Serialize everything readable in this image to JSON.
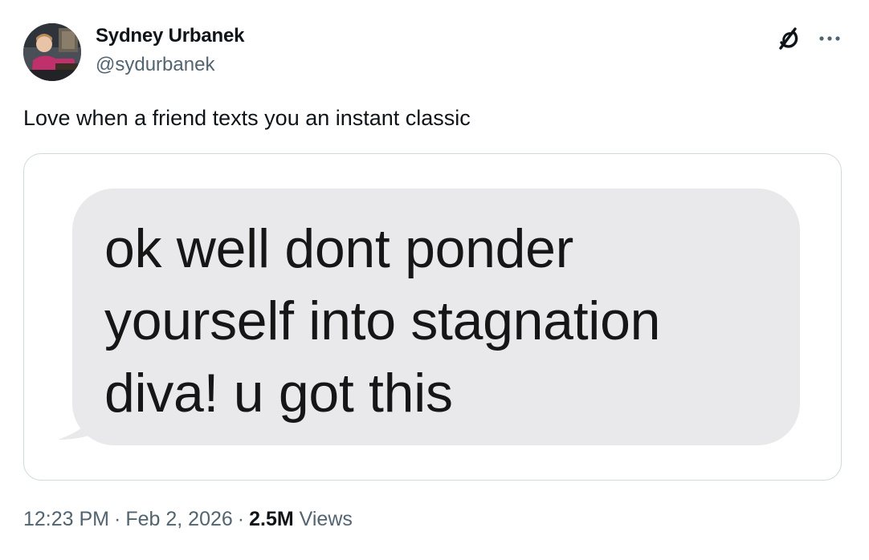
{
  "author": {
    "name": "Sydney Urbanek",
    "handle": "@sydurbanek"
  },
  "tweet": {
    "text": "Love when a friend texts you an instant classic"
  },
  "media": {
    "message_lines": [
      "ok well dont ponder",
      "yourself into stagnation",
      "diva! u got this"
    ]
  },
  "meta": {
    "time": "12:23 PM",
    "separator": "·",
    "date": "Feb 2, 2026",
    "views_count": "2.5M",
    "views_label": "Views"
  },
  "icons": {
    "grok": "grok-icon",
    "more": "more-icon"
  },
  "colors": {
    "text_primary": "#0f1419",
    "text_secondary": "#536471",
    "card_border": "#cfd9de",
    "bubble_gray": "#e9e9eb"
  }
}
